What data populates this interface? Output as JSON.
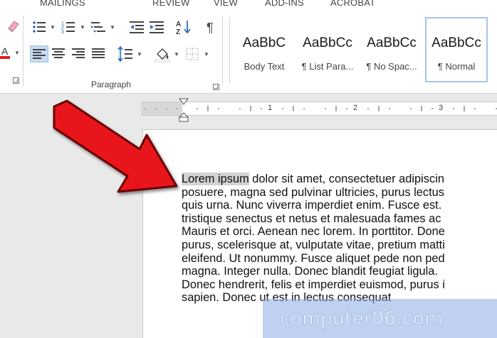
{
  "ribbon": {
    "tabs": [
      "MAILINGS",
      "REVIEW",
      "VIEW",
      "ADD-INS",
      "ACROBAT"
    ],
    "paragraph_group_label": "Paragraph",
    "styles": [
      {
        "sample": "AaBbC",
        "name": "Body Text"
      },
      {
        "sample": "AaBbCc",
        "name": "¶ List Para..."
      },
      {
        "sample": "AaBbCc",
        "name": "¶ No Spac..."
      },
      {
        "sample": "AaBbCc",
        "name": "¶ Normal"
      }
    ]
  },
  "ruler": {
    "numbers": [
      "1",
      "2",
      "3"
    ]
  },
  "document": {
    "lines": [
      {
        "selected": "Lorem ipsum",
        "rest": " dolor sit amet, consectetuer adipiscin"
      },
      {
        "text": "posuere, magna sed pulvinar ultricies, purus lectus"
      },
      {
        "text": "quis urna. Nunc viverra imperdiet enim. Fusce est."
      },
      {
        "text": "tristique senectus et netus et malesuada fames ac"
      },
      {
        "text": "Mauris et orci. Aenean nec lorem. In porttitor. Done"
      },
      {
        "text": "purus, scelerisque at, vulputate vitae, pretium matti"
      },
      {
        "text": "eleifend. Ut nonummy. Fusce aliquet pede non ped"
      },
      {
        "text": "magna. Integer nulla. Donec blandit feugiat ligula."
      },
      {
        "text": "Donec hendrerit, felis et imperdiet euismod, purus i"
      },
      {
        "text": "sapien. Donec ut est in lectus consequat"
      }
    ]
  },
  "watermark": "computer06.com",
  "colors": {
    "arrow_red": "#e8141b",
    "selection_gray": "#d2d2d2",
    "selection_blue": "#8aaae6"
  }
}
